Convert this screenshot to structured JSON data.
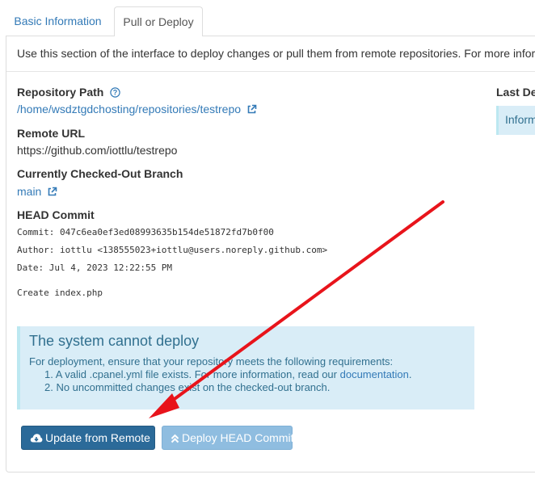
{
  "tabs": {
    "basic": "Basic Information",
    "pull": "Pull or Deploy"
  },
  "intro": "Use this section of the interface to deploy changes or pull them from remote repositories. For more informati",
  "repo_path": {
    "label": "Repository Path",
    "value": "/home/wsdztgdchosting/repositories/testrepo"
  },
  "remote_url": {
    "label": "Remote URL",
    "value": "https://github.com/iottlu/testrepo"
  },
  "branch": {
    "label": "Currently Checked-Out Branch",
    "value": "main"
  },
  "head_commit": {
    "label": "HEAD Commit",
    "commit": "Commit: 047c6ea0ef3ed08993635b154de51872fd7b0f00",
    "author": "Author: iottlu <138555023+iottlu@users.noreply.github.com>",
    "date": "Date: Jul 4, 2023 12:22:55 PM",
    "message": "Create index.php"
  },
  "alert": {
    "title": "The system cannot deploy",
    "text": "For deployment, ensure that your repository meets the following requirements:",
    "item1_prefix": "1. A valid .cpanel.yml file exists. For more information, read our ",
    "item1_link": "documentation",
    "item1_suffix": ".",
    "item2": "2. No uncommitted changes exist on the checked-out branch."
  },
  "buttons": {
    "update": "Update from Remote",
    "deploy": "Deploy HEAD Commit"
  },
  "right": {
    "label": "Last Dep",
    "box": "Inform"
  },
  "colors": {
    "link": "#337ab7",
    "primary": "#2b6a99",
    "alert_bg": "#d9edf7",
    "annotation_arrow": "#e8141b"
  }
}
